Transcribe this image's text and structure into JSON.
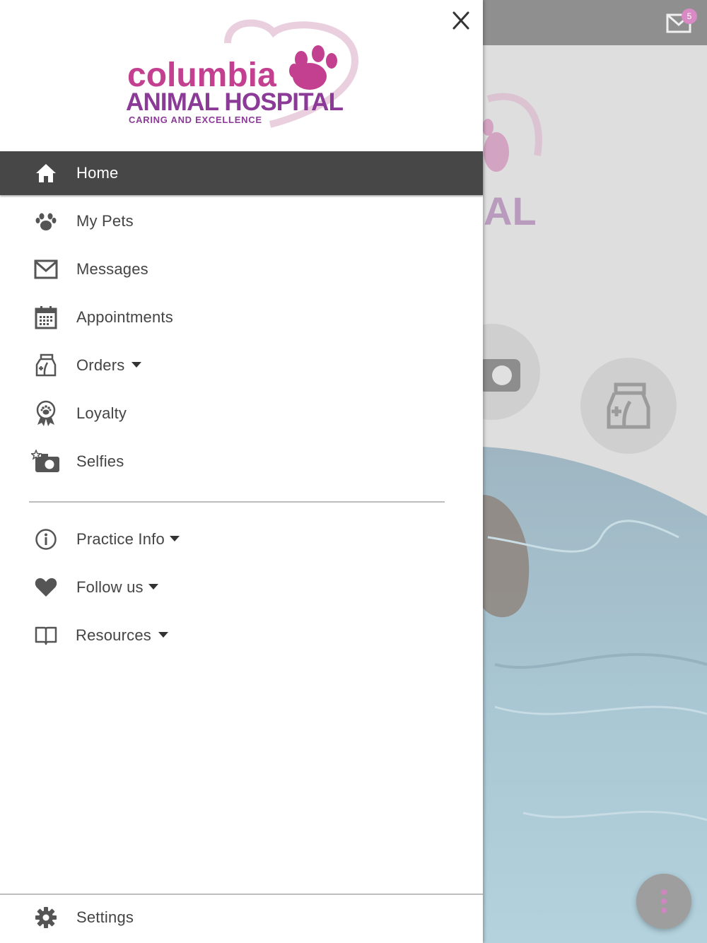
{
  "background": {
    "mail_badge_count": "5",
    "logo_fragment_text": "AL"
  },
  "drawer": {
    "logo": {
      "line1": "columbia",
      "line2": "ANIMAL HOSPITAL",
      "tagline": "CARING AND EXCELLENCE"
    },
    "menu_items": [
      {
        "label": "Home",
        "icon": "home-icon",
        "active": true
      },
      {
        "label": "My Pets",
        "icon": "paw-icon"
      },
      {
        "label": "Messages",
        "icon": "envelope-icon"
      },
      {
        "label": "Appointments",
        "icon": "calendar-icon"
      },
      {
        "label": "Orders",
        "icon": "pet-food-bag-icon",
        "has_dropdown": true
      },
      {
        "label": "Loyalty",
        "icon": "award-ribbon-icon"
      },
      {
        "label": "Selfies",
        "icon": "camera-star-icon"
      }
    ],
    "secondary_items": [
      {
        "label": "Practice Info",
        "icon": "info-icon",
        "has_dropdown": true
      },
      {
        "label": "Follow us",
        "icon": "heart-icon",
        "has_dropdown": true
      },
      {
        "label": "Resources",
        "icon": "book-icon",
        "has_dropdown": true
      }
    ],
    "footer_item": {
      "label": "Settings",
      "icon": "gear-icon"
    }
  },
  "colors": {
    "brand_pink": "#c2408f",
    "brand_purple": "#8b3a97",
    "active_bg": "#474747"
  }
}
